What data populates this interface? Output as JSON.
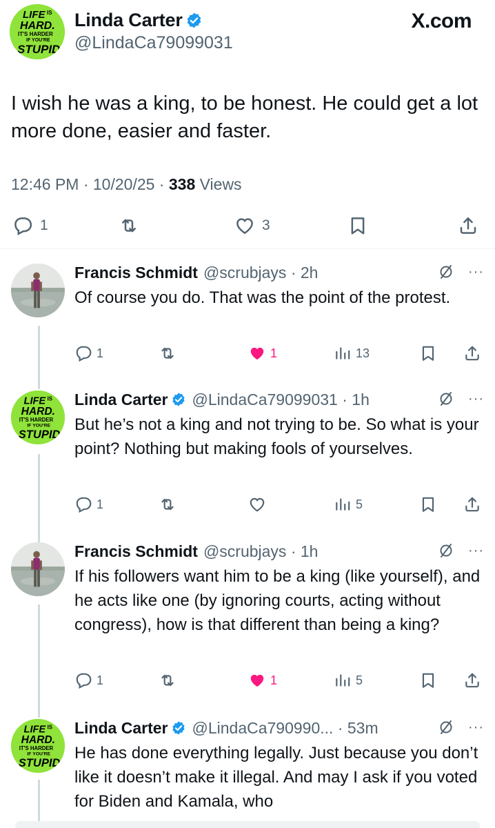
{
  "site_label": "X.com",
  "main_tweet": {
    "author_name": "Linda Carter",
    "author_handle": "@LindaCa79099031",
    "avatar_text": [
      "LIFE",
      "IS",
      "HARD.",
      "IT'S HARDER",
      "IF YOU'RE",
      "STUPID"
    ],
    "text": "I wish he was a king, to be honest. He could get a lot more done, easier and faster.",
    "timestamp": "12:46 PM · 10/20/25 · ",
    "views_count": "338",
    "views_label": " Views",
    "actions": {
      "replies": "1",
      "retweets": "",
      "likes": "3"
    }
  },
  "replies": [
    {
      "author_name": "Francis Schmidt",
      "author_handle": "@scrubjays · 2h",
      "verified": false,
      "text": "Of course you do. That was the point of the protest.",
      "replies": "1",
      "likes": "1",
      "liked": true,
      "views": "13"
    },
    {
      "author_name": "Linda Carter",
      "author_handle": "@LindaCa79099031 · 1h",
      "verified": true,
      "text": "But he’s not a king and not trying to be. So what is your point?  Nothing but making fools of yourselves.",
      "replies": "1",
      "likes": "",
      "liked": false,
      "views": "5"
    },
    {
      "author_name": "Francis Schmidt",
      "author_handle": "@scrubjays · 1h",
      "verified": false,
      "text": "If his followers want him to be a king (like yourself), and he acts like one (by ignoring courts, acting without congress), how is that different than being a king?",
      "replies": "1",
      "likes": "1",
      "liked": true,
      "views": "5"
    },
    {
      "author_name": "Linda Carter",
      "author_handle": "@LindaCa790990... · 53m",
      "verified": true,
      "text": "He has done everything legally. Just because you don’t like it doesn’t make it illegal. And may I ask if you voted for Biden and Kamala, who"
    }
  ],
  "colors": {
    "accent": "#1d9bf0",
    "like": "#f91880",
    "muted": "#536471",
    "logo_green": "#8fe33a"
  }
}
